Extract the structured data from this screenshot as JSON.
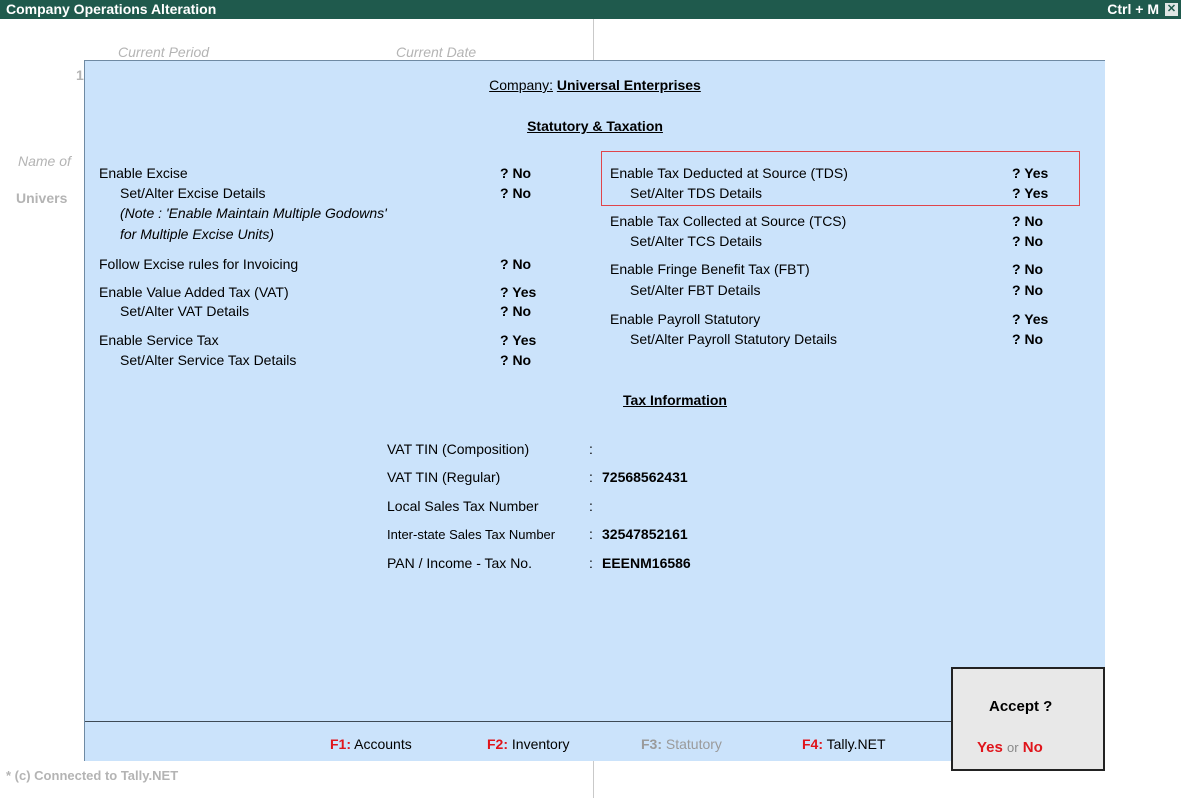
{
  "window": {
    "title": "Company Operations  Alteration",
    "shortcut": "Ctrl + M",
    "close_glyph": "✕"
  },
  "background": {
    "current_period": "Current Period",
    "current_date": "Current Date",
    "period_fragment": "1",
    "name_of": "Name of",
    "company_fragment": "Univers",
    "connected": "* (c) Connected to Tally.NET"
  },
  "header": {
    "company_label": "Company:",
    "company_name": "Universal Enterprises"
  },
  "sections": {
    "statutory": "Statutory & Taxation",
    "tax_info": "Tax Information"
  },
  "left": {
    "excise": {
      "label": "Enable Excise",
      "value": "? No"
    },
    "excise_details": {
      "label": "Set/Alter Excise Details",
      "value": "? No"
    },
    "note1": "(Note : 'Enable Maintain Multiple Godowns'",
    "note2": "for Multiple Excise Units)",
    "follow_excise": {
      "label": "Follow Excise rules for Invoicing",
      "value": "? No"
    },
    "vat": {
      "label": "Enable Value Added Tax (VAT)",
      "value": "? Yes"
    },
    "vat_details": {
      "label": "Set/Alter VAT Details",
      "value": "? No"
    },
    "service_tax": {
      "label": "Enable Service Tax",
      "value": "? Yes"
    },
    "service_tax_details": {
      "label": "Set/Alter Service Tax Details",
      "value": "? No"
    }
  },
  "right": {
    "tds": {
      "label": "Enable Tax Deducted at Source (TDS)",
      "value": "? Yes"
    },
    "tds_details": {
      "label": "Set/Alter TDS Details",
      "value": "? Yes"
    },
    "tcs": {
      "label": "Enable Tax Collected at Source (TCS)",
      "value": "? No"
    },
    "tcs_details": {
      "label": "Set/Alter TCS Details",
      "value": "? No"
    },
    "fbt": {
      "label": "Enable Fringe Benefit Tax (FBT)",
      "value": "? No"
    },
    "fbt_details": {
      "label": "Set/Alter FBT Details",
      "value": "? No"
    },
    "payroll": {
      "label": "Enable Payroll Statutory",
      "value": "? Yes"
    },
    "payroll_details": {
      "label": "Set/Alter Payroll Statutory Details",
      "value": "? No"
    }
  },
  "tax_info": {
    "vat_comp": {
      "label": "VAT TIN (Composition)",
      "sep": ":",
      "value": ""
    },
    "vat_reg": {
      "label": "VAT TIN (Regular)",
      "sep": ":",
      "value": "72568562431"
    },
    "local_sales": {
      "label": "Local Sales Tax Number",
      "sep": ":",
      "value": ""
    },
    "interstate": {
      "label": "Inter-state Sales Tax Number",
      "sep": ":",
      "value": "32547852161"
    },
    "pan": {
      "label": "PAN / Income - Tax No.",
      "sep": ":",
      "value": "EEENM16586"
    }
  },
  "footer": {
    "f1": {
      "key": "F1:",
      "label": "Accounts"
    },
    "f2": {
      "key": "F2:",
      "label": "Inventory"
    },
    "f3": {
      "key": "F3:",
      "label": "Statutory"
    },
    "f4": {
      "key": "F4:",
      "label": "Tally.NET"
    }
  },
  "accept": {
    "question": "Accept ?",
    "yes": "Yes",
    "or": "or",
    "no": "No"
  }
}
